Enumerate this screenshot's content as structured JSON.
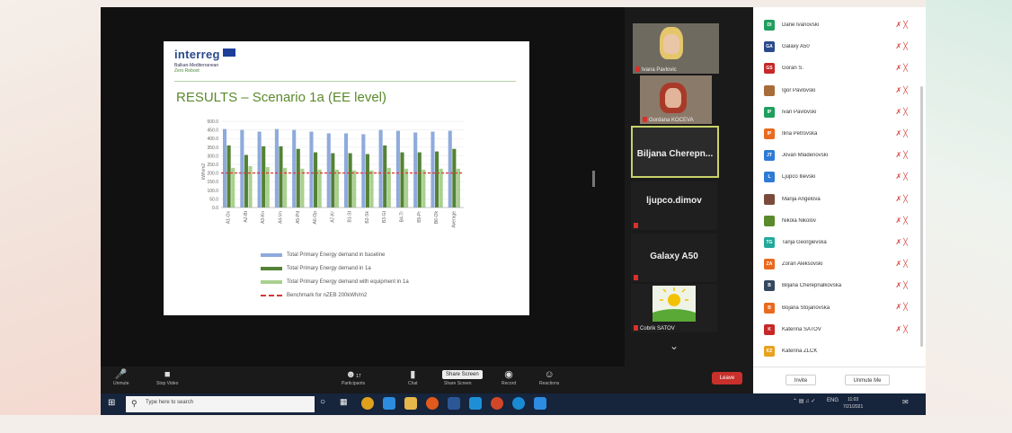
{
  "slide": {
    "logo": "interreg",
    "logo_sub": "Balkan-Mediterranean",
    "logo_sub2": "Zero Reboot",
    "title": "RESULTS – Scenario 1a (EE level)",
    "legend": [
      "Total Primary Energy demand in baseline",
      "Total Primary Energy demand in 1a",
      "Total Primary Energy demand with equipment in 1a",
      "Benchmark for nZEB 200kWh/m2"
    ]
  },
  "chart_data": {
    "type": "bar",
    "categories": [
      "A1-Ox",
      "A2-Bt",
      "A3-Kn",
      "A4-Vn",
      "A5-Pd",
      "A6-Op",
      "A7-Kr",
      "B1-St",
      "B2-Sk",
      "B3-Gt",
      "B4-Tr",
      "B5-Pr",
      "B6-Ok",
      "Average"
    ],
    "series": [
      {
        "name": "Total Primary Energy demand in baseline",
        "values": [
          455,
          450,
          440,
          455,
          450,
          440,
          430,
          430,
          425,
          450,
          445,
          435,
          440,
          445
        ]
      },
      {
        "name": "Total Primary Energy demand in 1a",
        "values": [
          360,
          305,
          355,
          355,
          340,
          320,
          315,
          315,
          310,
          360,
          320,
          320,
          325,
          340
        ]
      },
      {
        "name": "Total Primary Energy demand with equipment in 1a",
        "values": [
          230,
          240,
          235,
          230,
          225,
          220,
          220,
          215,
          215,
          230,
          225,
          220,
          225,
          225
        ]
      }
    ],
    "benchmark": 200,
    "ylim": [
      0,
      500
    ],
    "yticks": [
      "0.0",
      "50.0",
      "100.0",
      "150.0",
      "200.0",
      "250.0",
      "300.0",
      "350.0",
      "400.0",
      "450.0",
      "500.0"
    ],
    "ylabel": "kWh/m2",
    "colors": [
      "#8faadc",
      "#548235",
      "#a9d18e",
      "#e03b3b"
    ]
  },
  "videos": [
    {
      "name": "Ivana Pavlovic"
    },
    {
      "name": "Gordana KOCEVA"
    },
    {
      "name": "Biljana  Cherepn..."
    },
    {
      "name": "ljupco.dimov"
    },
    {
      "name": "Galaxy A50"
    },
    {
      "name": "Cobrik SATOV"
    }
  ],
  "toolbar": {
    "unmute": "Unmute",
    "stop_video": "Stop Video",
    "participants": "Participants",
    "participants_count": "17",
    "chat": "Chat",
    "share_screen": "Share Screen",
    "record": "Record",
    "reactions": "Reactions",
    "tooltip": "Share Screen",
    "leave": "Leave"
  },
  "participants": [
    {
      "initials": "DI",
      "name": "Dane Ivanovski",
      "color": "#1f9e5e"
    },
    {
      "initials": "GA",
      "name": "Galaxy A50",
      "color": "#2b4a8a"
    },
    {
      "initials": "GS",
      "name": "Goran S.",
      "color": "#c62828"
    },
    {
      "initials": "",
      "name": "Igor Pavlovski",
      "color": "#a86c3a"
    },
    {
      "initials": "IP",
      "name": "Ivan Pavlovski",
      "color": "#1f9e5e"
    },
    {
      "initials": "IP",
      "name": "Ilina Petrovska",
      "color": "#e86a1f"
    },
    {
      "initials": "JT",
      "name": "Jovan Mladenovski",
      "color": "#2e7bd6"
    },
    {
      "initials": "L",
      "name": "Ljupco Ilievski",
      "color": "#2e7bd6"
    },
    {
      "initials": "",
      "name": "Marija Angelova",
      "color": "#7a4b3a"
    },
    {
      "initials": "",
      "name": "Nikola Nikolov",
      "color": "#5a8a2c"
    },
    {
      "initials": "TG",
      "name": "Tanja Georgievska",
      "color": "#22a99a"
    },
    {
      "initials": "ZA",
      "name": "Zoran Aleksovski",
      "color": "#e86a1f"
    },
    {
      "initials": "B",
      "name": "Biljana Cherepnalkovska",
      "color": "#34495e"
    },
    {
      "initials": "B",
      "name": "Bojana Stojanovska",
      "color": "#e86a1f"
    },
    {
      "initials": "K",
      "name": "Katerina SATOV",
      "color": "#c62828"
    },
    {
      "initials": "KZ",
      "name": "Katerina ZLCK",
      "color": "#e8a21f"
    }
  ],
  "panel_footer": {
    "invite": "Invite",
    "unmute_me": "Unmute Me"
  },
  "taskbar": {
    "search_placeholder": "Type here to search",
    "lang": "ENG",
    "time": "11:03",
    "date": "7/21/2021"
  }
}
